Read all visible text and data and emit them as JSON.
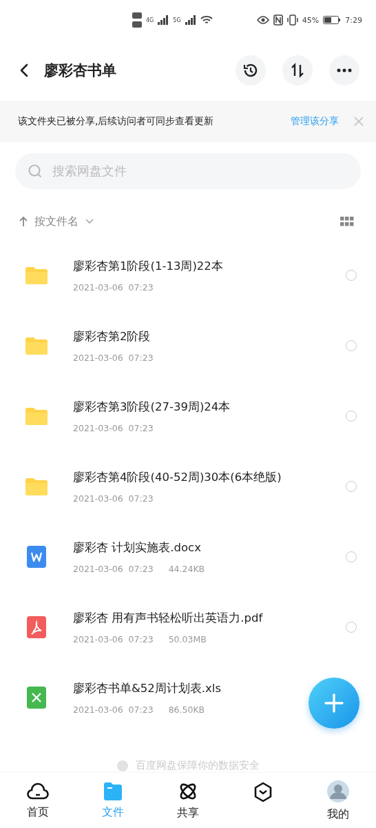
{
  "status_bar": {
    "network_1": "4G",
    "network_2": "5G",
    "battery": "45%",
    "time": "7:29"
  },
  "header": {
    "title": "廖彩杏书单"
  },
  "share_banner": {
    "text": "该文件夹已被分享,后续访问者可同步查看更新",
    "action": "管理该分享"
  },
  "search": {
    "placeholder": "搜索网盘文件"
  },
  "sort": {
    "label": "按文件名"
  },
  "files": [
    {
      "kind": "folder",
      "name": "廖彩杏第1阶段(1-13周)22本",
      "date": "2021-03-06  07:23",
      "selected": false
    },
    {
      "kind": "folder",
      "name": "廖彩杏第2阶段",
      "date": "2021-03-06  07:23",
      "selected": false
    },
    {
      "kind": "folder",
      "name": "廖彩杏第3阶段(27-39周)24本",
      "date": "2021-03-06  07:23",
      "selected": false
    },
    {
      "kind": "folder",
      "name": "廖彩杏第4阶段(40-52周)30本(6本绝版)",
      "date": "2021-03-06  07:23",
      "selected": false
    },
    {
      "kind": "word",
      "name": "廖彩杏 计划实施表.docx",
      "date": "2021-03-06  07:23",
      "size": "44.24KB",
      "selected": false
    },
    {
      "kind": "pdf",
      "name": "廖彩杏 用有声书轻松听出英语力.pdf",
      "date": "2021-03-06  07:23",
      "size": "50.03MB",
      "selected": false
    },
    {
      "kind": "excel",
      "name": "廖彩杏书单&52周计划表.xls",
      "date": "2021-03-06  07:23",
      "size": "86.50KB"
    }
  ],
  "footer_note": "百度网盘保障你的数据安全",
  "nav": [
    {
      "kind": "home",
      "label": "首页",
      "selected": false
    },
    {
      "kind": "files",
      "label": "文件",
      "selected": true
    },
    {
      "kind": "share",
      "label": "共享",
      "selected": false
    },
    {
      "kind": "discover",
      "selected": false
    },
    {
      "kind": "profile",
      "label": "我的",
      "selected": false
    }
  ]
}
